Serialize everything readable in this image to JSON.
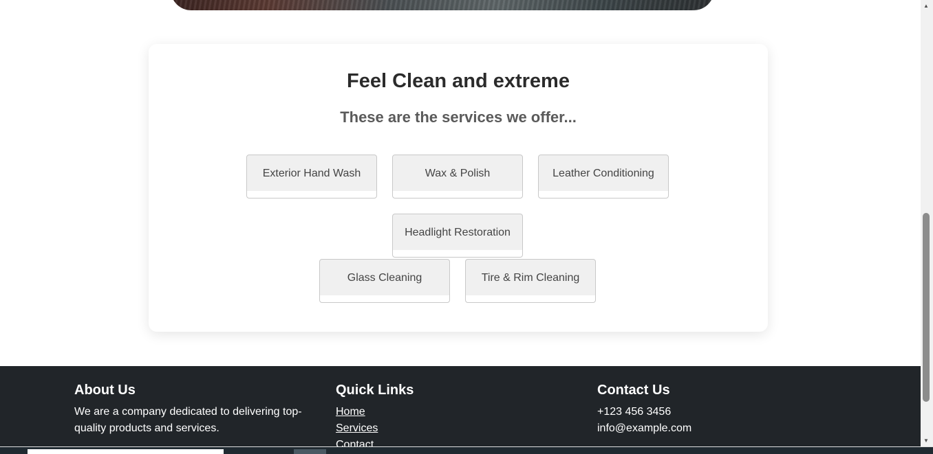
{
  "services": {
    "title": "Feel Clean and extreme",
    "subtitle": "These are the services we offer...",
    "items": [
      {
        "label": "Exterior Hand Wash"
      },
      {
        "label": "Wax & Polish"
      },
      {
        "label": "Leather Conditioning"
      },
      {
        "label": "Headlight Restoration"
      },
      {
        "label": "Glass Cleaning"
      },
      {
        "label": "Tire & Rim Cleaning"
      }
    ]
  },
  "footer": {
    "about": {
      "heading": "About Us",
      "text": "We are a company dedicated to delivering top-quality products and services."
    },
    "links": {
      "heading": "Quick Links",
      "items": [
        "Home",
        "Services",
        "Contact"
      ]
    },
    "contact": {
      "heading": "Contact Us",
      "phone": "+123 456 3456",
      "email": "info@example.com"
    }
  },
  "colors": {
    "footer_bg": "#212529",
    "button_bg": "#f0f0f0",
    "title_text": "#2b2b2b"
  },
  "icons": {
    "scroll_up": "scroll-up-arrow-icon",
    "scroll_down": "scroll-down-arrow-icon"
  }
}
